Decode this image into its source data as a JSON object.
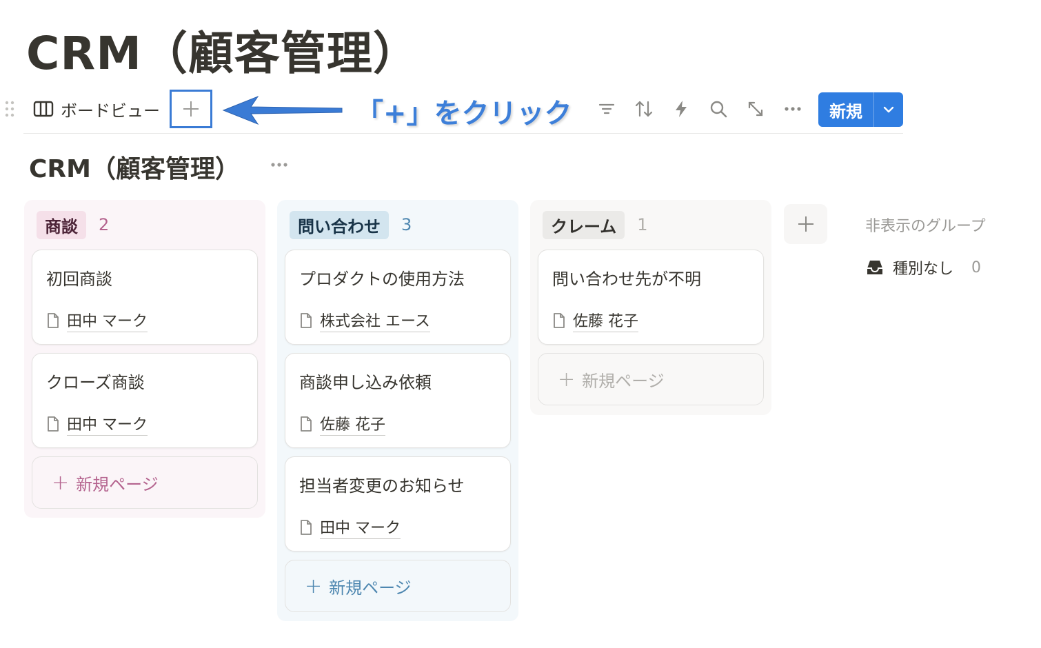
{
  "page": {
    "title": "CRM（顧客管理）"
  },
  "toolbar": {
    "view_label": "ボードビュー",
    "annotation_text": "「+」をクリック",
    "new_button_label": "新規",
    "accent_color": "#2f7de1",
    "annotation_color": "#3a7bd5",
    "icons": [
      "filter-icon",
      "sort-icon",
      "automation-bolt-icon",
      "search-icon",
      "expand-icon",
      "more-icon"
    ]
  },
  "database": {
    "title": "CRM（顧客管理）"
  },
  "board": {
    "columns": [
      {
        "tag": "商談",
        "count": "2",
        "tag_bg": "#f5e0e9",
        "tag_color": "#4c2337",
        "count_color": "#b4638e",
        "cards": [
          {
            "title": "初回商談",
            "relation": "田中 マーク"
          },
          {
            "title": "クローズ商談",
            "relation": "田中 マーク"
          }
        ],
        "new_page_label": "新規ページ",
        "new_page_color": "#b4638e"
      },
      {
        "tag": "問い合わせ",
        "count": "3",
        "tag_bg": "#d3e5ef",
        "tag_color": "#183347",
        "count_color": "#4e87b0",
        "cards": [
          {
            "title": "プロダクトの使用方法",
            "relation": "株式会社 エース"
          },
          {
            "title": "商談申し込み依頼",
            "relation": "佐藤 花子"
          },
          {
            "title": "担当者変更のお知らせ",
            "relation": "田中 マーク"
          }
        ],
        "new_page_label": "新規ページ",
        "new_page_color": "#4e87b0"
      },
      {
        "tag": "クレーム",
        "count": "1",
        "tag_bg": "#ebeae8",
        "tag_color": "#32302c",
        "count_color": "#b0aeaa",
        "cards": [
          {
            "title": "問い合わせ先が不明",
            "relation": "佐藤 花子"
          }
        ],
        "new_page_label": "新規ページ",
        "new_page_color": "#b0aeaa"
      }
    ],
    "hidden_groups": {
      "title": "非表示のグループ",
      "items": [
        {
          "label": "種別なし",
          "count": "0"
        }
      ]
    }
  }
}
